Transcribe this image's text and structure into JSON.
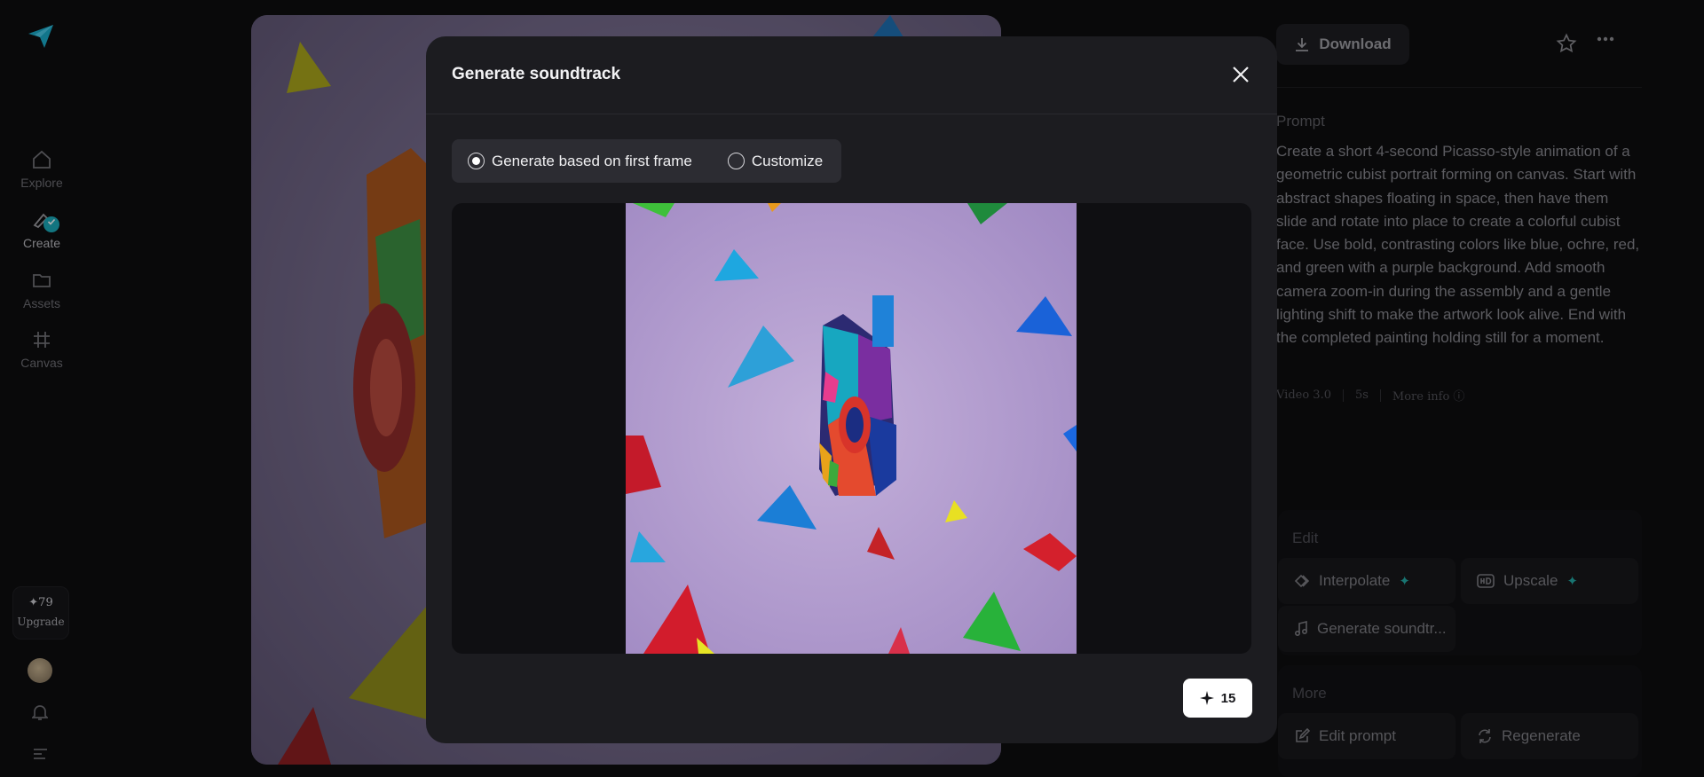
{
  "nav": {
    "logo_icon": "paper-plane-logo",
    "items": [
      {
        "label": "Explore",
        "icon": "home-icon"
      },
      {
        "label": "Create",
        "icon": "create-brush-icon"
      },
      {
        "label": "Assets",
        "icon": "folder-icon"
      },
      {
        "label": "Canvas",
        "icon": "canvas-frame-icon"
      }
    ],
    "credits": {
      "value": "79",
      "icon": "sparkle-icon",
      "upgrade_label": "Upgrade"
    },
    "avatar": "user-avatar",
    "notifications_icon": "bell-icon",
    "menu_icon": "menu-icon"
  },
  "detail": {
    "download_label": "Download",
    "favorite_icon": "star-icon",
    "more_icon": "ellipsis-icon",
    "prompt_label": "Prompt",
    "prompt_text": "Create a short 4-second Picasso-style animation of a geometric cubist portrait forming on canvas. Start with abstract shapes floating in space, then have them slide and rotate into place to create a colorful cubist face. Use bold, contrasting colors like blue, ochre, red, and green with a purple background. Add smooth camera zoom-in during the assembly and a gentle lighting shift to make the artwork look alive. End with the completed painting holding still for a moment.",
    "model": "Video 3.0",
    "duration": "5s",
    "more_info": "More info",
    "edit_section": {
      "title": "Edit",
      "actions": [
        {
          "label": "Interpolate",
          "icon": "interpolate-icon",
          "premium": true
        },
        {
          "label": "Upscale",
          "icon": "hd-icon",
          "premium": true
        },
        {
          "label": "Generate soundtr...",
          "icon": "music-note-icon",
          "premium": false
        }
      ]
    },
    "more_section": {
      "title": "More",
      "actions": [
        {
          "label": "Edit prompt",
          "icon": "edit-prompt-icon"
        },
        {
          "label": "Regenerate",
          "icon": "regenerate-icon"
        }
      ]
    }
  },
  "modal": {
    "title": "Generate soundtrack",
    "options": [
      {
        "label": "Generate based on first frame",
        "selected": true
      },
      {
        "label": "Customize",
        "selected": false
      }
    ],
    "generate_cost": "15",
    "generate_icon": "sparkle-icon",
    "close_icon": "close-icon"
  },
  "colors": {
    "accent_teal": "#1ba8b8",
    "modal_bg": "#1c1c20",
    "frame_purple": "#b9a5d4"
  }
}
